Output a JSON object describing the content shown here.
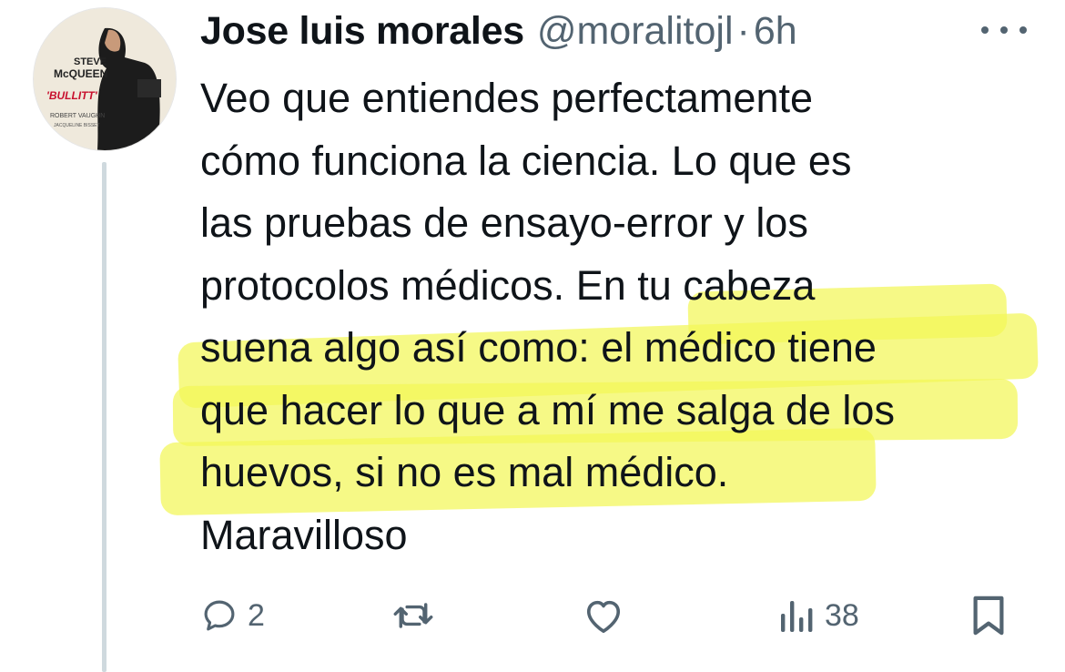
{
  "tweet": {
    "author_name": "Jose luis morales",
    "handle": "@moralitojl",
    "separator": "·",
    "time": "6h",
    "avatar_poster": {
      "line1": "STEVE",
      "line2": "McQUEEN",
      "line3": "'BULLITT'",
      "line4": "ROBERT VAUGHN",
      "line5": "JACQUELINE BISSET"
    },
    "lines": [
      "Veo que entiendes perfectamente",
      "cómo funciona la ciencia. Lo que es",
      "las pruebas de ensayo-error y los",
      "protocolos médicos. En tu cabeza",
      "suena algo así como: el médico tiene",
      "que hacer lo que a mí me salga de los",
      "huevos, si no es mal médico.",
      "Maravilloso"
    ],
    "highlight_color": "#f2f757"
  },
  "actions": {
    "reply_count": "2",
    "views_count": "38"
  },
  "icons": [
    "reply-icon",
    "retweet-icon",
    "like-icon",
    "views-icon",
    "bookmark-icon",
    "more-icon"
  ]
}
